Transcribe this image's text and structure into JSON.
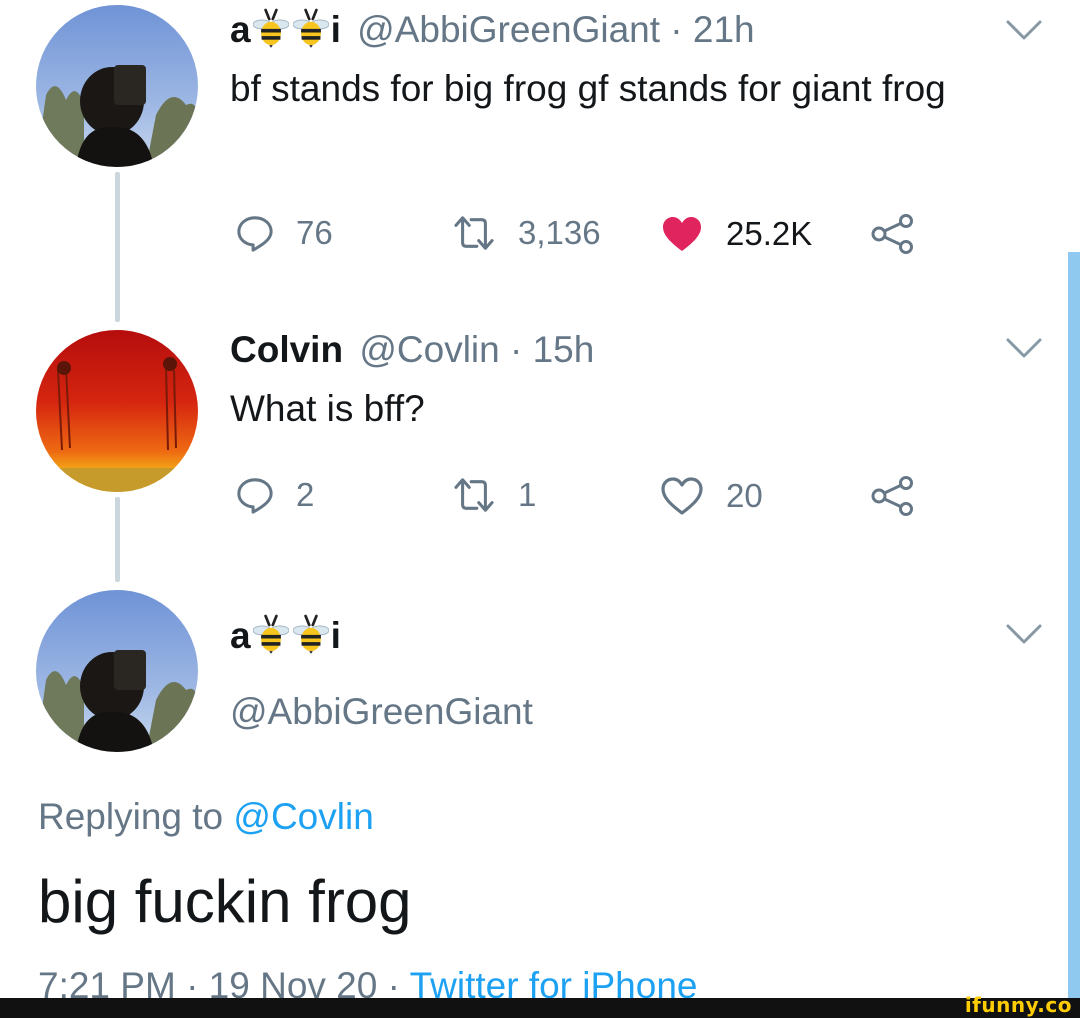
{
  "tweet1": {
    "name_prefix": "a",
    "name_suffix": "i",
    "handle_time": "@AbbiGreenGiant · 21h",
    "text": "bf stands for big frog gf stands for giant frog",
    "replies": "76",
    "retweets": "3,136",
    "likes": "25.2K",
    "liked": true
  },
  "tweet2": {
    "name": "Colvin",
    "handle_time": "@Covlin · 15h",
    "text": "What is bff?",
    "replies": "2",
    "retweets": "1",
    "likes": "20"
  },
  "tweet3": {
    "name_prefix": "a",
    "name_suffix": "i",
    "handle": "@AbbiGreenGiant",
    "replying_prefix": "Replying to",
    "replying_handle": "@Covlin",
    "text": "big fuckin frog",
    "timestamp": "7:21 PM · 19 Nov 20 · ",
    "source": "Twitter for iPhone"
  },
  "watermark": "ifunny.co",
  "colors": {
    "like_red": "#e0245e",
    "link_blue": "#1da1f2",
    "secondary_gray": "#657786",
    "thread_line": "#ccd6dd"
  },
  "icons": [
    "reply-icon",
    "retweet-icon",
    "like-icon",
    "share-icon",
    "chevron-down-icon",
    "bee-emoji"
  ]
}
